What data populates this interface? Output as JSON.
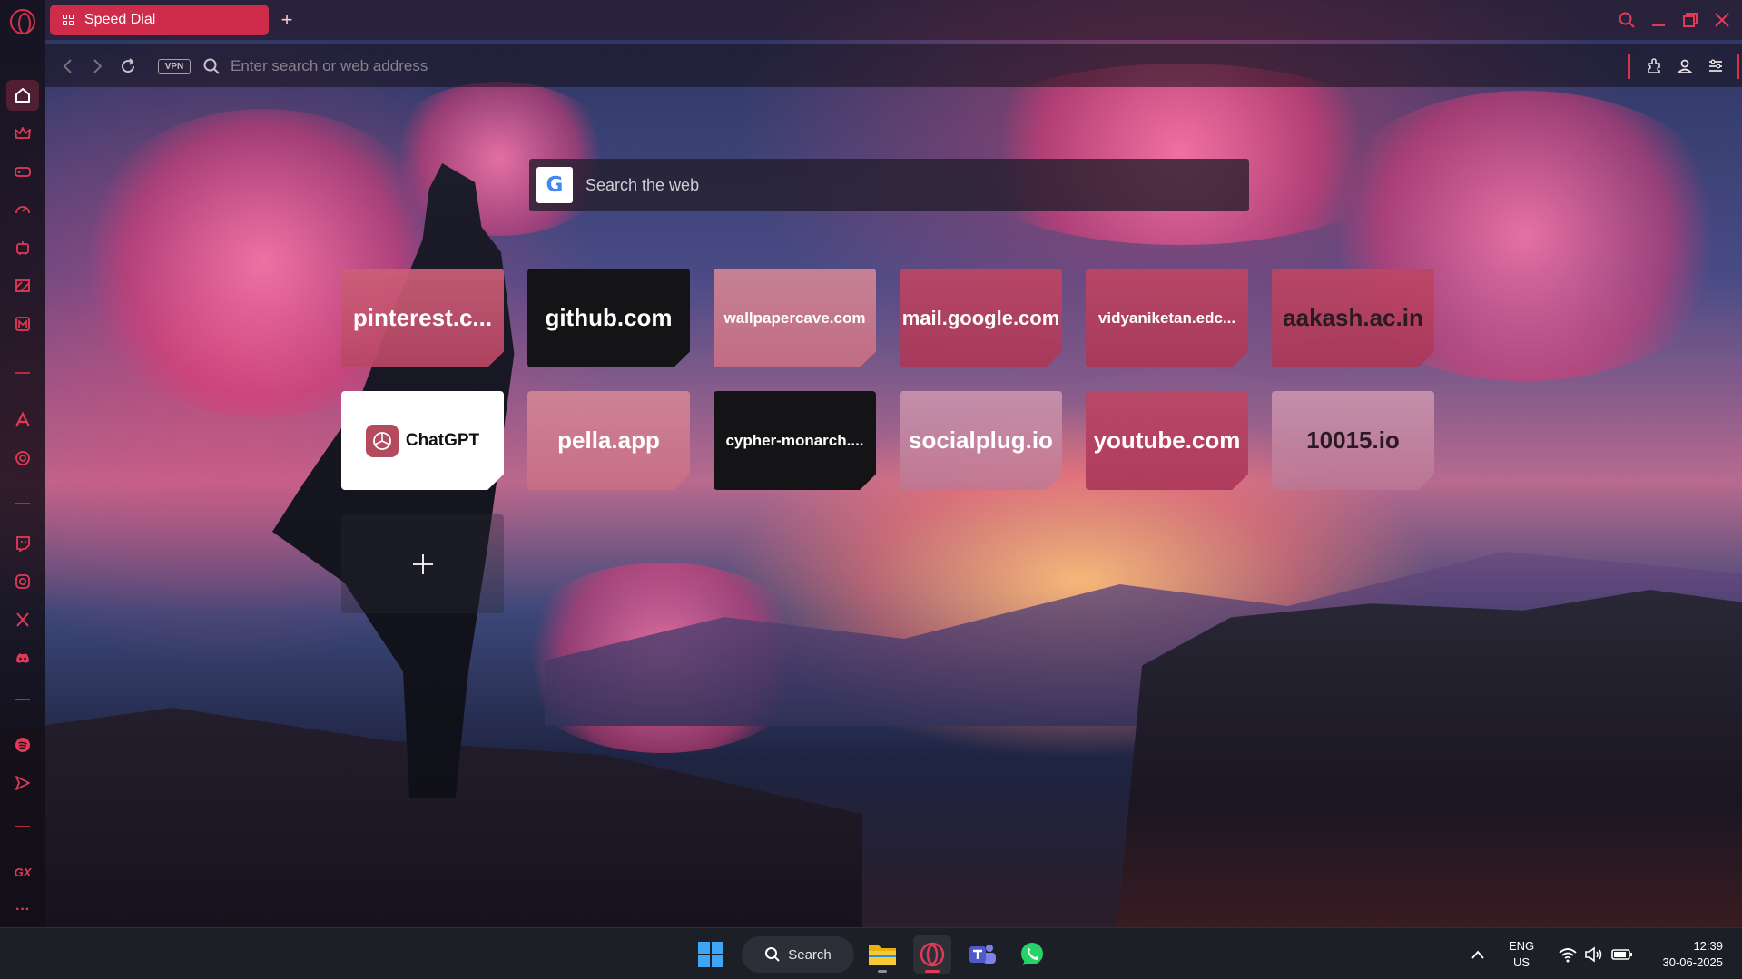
{
  "tabs": [
    {
      "label": "Speed Dial",
      "icon": "grid-icon"
    }
  ],
  "address_bar": {
    "placeholder": "Enter search or web address",
    "vpn_label": "VPN"
  },
  "search_box": {
    "placeholder": "Search the web",
    "logo": "G"
  },
  "speed_dial": [
    {
      "label": "pinterest.c...",
      "style": "pink"
    },
    {
      "label": "github.com",
      "style": "dark"
    },
    {
      "label": "wallpapercave.com",
      "style": "light-pink"
    },
    {
      "label": "mail.google.com",
      "style": "rose"
    },
    {
      "label": "vidyaniketan.edc...",
      "style": "rose"
    },
    {
      "label": "aakash.ac.in",
      "style": "rose"
    },
    {
      "label": "ChatGPT",
      "style": "white"
    },
    {
      "label": "pella.app",
      "style": "light-pink"
    },
    {
      "label": "cypher-monarch....",
      "style": "dark"
    },
    {
      "label": "socialplug.io",
      "style": "muted"
    },
    {
      "label": "youtube.com",
      "style": "rose"
    },
    {
      "label": "10015.io",
      "style": "muted"
    }
  ],
  "sidebar": {
    "items": [
      "home-icon",
      "crown-icon",
      "gamepad-icon",
      "speedometer-icon",
      "bot-icon",
      "ticker-icon",
      "maker-icon",
      "aria-icon",
      "chatgpt-icon",
      "twitch-icon",
      "instagram-icon",
      "x-icon",
      "discord-icon",
      "spotify-icon",
      "send-icon",
      "gx-icon",
      "more-icon"
    ],
    "gx_label": "GX",
    "more_label": "···"
  },
  "taskbar": {
    "search_label": "Search",
    "language_line1": "ENG",
    "language_line2": "US",
    "time": "12:39",
    "date": "30-06-2025"
  },
  "colors": {
    "accent": "#d8324a",
    "tab_active": "#cf2b4b",
    "taskbar": "#1c1f26"
  }
}
